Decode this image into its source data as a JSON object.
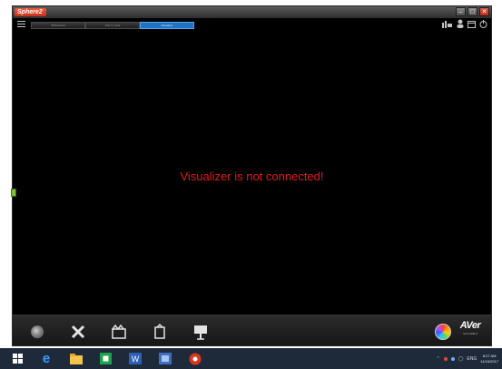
{
  "window": {
    "app_name": "Sphere2",
    "controls": [
      "minimize",
      "maximize",
      "close"
    ]
  },
  "menubar": {
    "tabs": [
      {
        "label": "Whiteboard",
        "active": false
      },
      {
        "label": "Side by Side",
        "active": false
      },
      {
        "label": "Visualizer",
        "active": true
      }
    ],
    "right_icons": [
      "camera-settings-icon",
      "user-icon",
      "folder-icon",
      "power-icon"
    ]
  },
  "main": {
    "status_message": "Visualizer is not connected!",
    "status_color": "#e31b1b"
  },
  "toolbar": {
    "tools": [
      "camera-lens-icon",
      "tools-icon",
      "record-icon",
      "annotate-icon",
      "presentation-icon"
    ],
    "brand_name": "AVer",
    "brand_version": "V2.3.2011.6"
  },
  "taskbar": {
    "apps": [
      "windows-start-icon",
      "internet-explorer-icon",
      "file-explorer-icon",
      "store-icon",
      "word-icon",
      "app-icon",
      "sphere2-taskbar-icon"
    ],
    "tray_language": "ENG",
    "clock_time": "8:27 AM",
    "clock_date": "11/16/2017"
  },
  "colors": {
    "app_background": "#000000",
    "active_tab": "#1f73c4",
    "logo_red": "#d9381e",
    "taskbar": "#1e2a3a"
  }
}
